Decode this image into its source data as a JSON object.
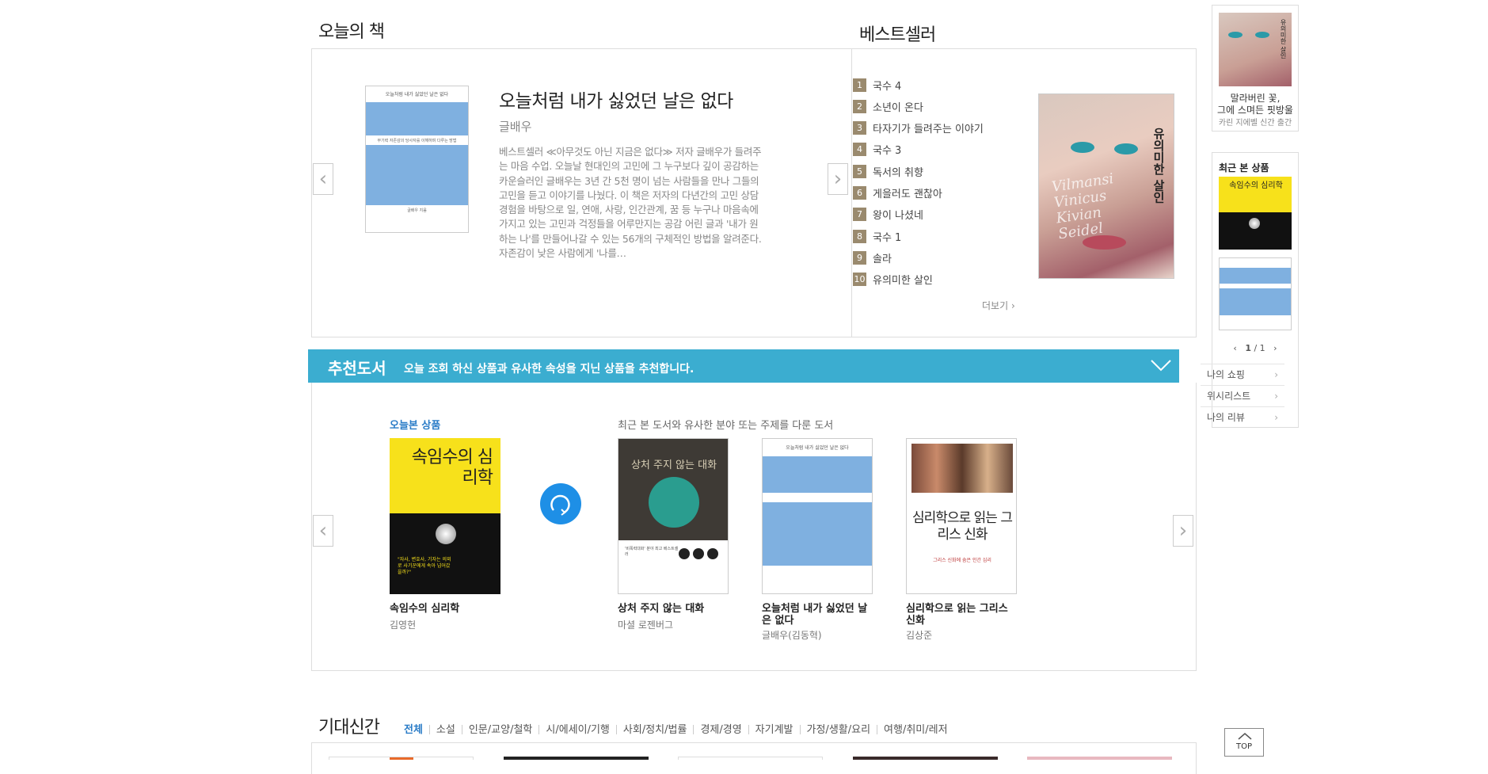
{
  "today_book": {
    "section_title": "오늘의 책",
    "book_title": "오늘처럼 내가 싫었던 날은 없다",
    "author": "글배우",
    "description": "베스트셀러 ≪아무것도 아닌 지금은 없다≫ 저자 글배우가 들려주는 마음 수업. 오늘날 현대인의 고민에 그 누구보다 깊이 공감하는 카운슬러인 글배우는 3년 간 5천 명이 넘는 사람들을 만나 그들의 고민을 듣고 이야기를 나눴다. 이 책은 저자의 다년간의 고민 상담 경험을 바탕으로 일, 연애, 사랑, 인간관계, 꿈 등 누구나 마음속에 가지고 있는 고민과 걱정들을 어루만지는 공감 어린 글과 '내가 원하는 나'를 만들어나갈 수 있는 56개의 구체적인 방법을 알려준다. 자존감이 낮은 사람에게 '나를…",
    "cover_top_text": "오늘처럼 내가 싫었던 날은 없다",
    "cover_mid_text": "무기력 자존감의 당사자를 이해하며 다루는 방법",
    "cover_author_text": "글배우 지음"
  },
  "bestseller": {
    "section_title": "베스트셀러",
    "items": [
      {
        "rank": "1",
        "title": "국수 4"
      },
      {
        "rank": "2",
        "title": "소년이 온다"
      },
      {
        "rank": "3",
        "title": "타자기가 들려주는 이야기"
      },
      {
        "rank": "4",
        "title": "국수 3"
      },
      {
        "rank": "5",
        "title": "독서의 취향"
      },
      {
        "rank": "6",
        "title": "게을러도 괜찮아"
      },
      {
        "rank": "7",
        "title": "왕이 나셨네"
      },
      {
        "rank": "8",
        "title": "국수 1"
      },
      {
        "rank": "9",
        "title": "솔라"
      },
      {
        "rank": "10",
        "title": "유의미한 살인"
      }
    ],
    "more_label": "더보기",
    "cover_title": "유의미한 살인",
    "cover_script": "Vilmansi Vinicus Kivian Seidel"
  },
  "recommend": {
    "title": "추천도서",
    "subtitle": "오늘 조회 하신 상품과 유사한 속성을 지닌 상품을 추천합니다.",
    "today_label": "오늘본 상품",
    "similar_label": "최근 본 도서와 유사한 분야 또는 주제를 다룬 도서",
    "books": [
      {
        "title": "속임수의 심리학",
        "author": "김영헌",
        "cover_text": "속임수의 심리학",
        "cover_note": "\"자사, 변호사, 기자는 의외로 사기꾼에게 속아 넘어갔을까?\""
      },
      {
        "title": "상처 주지 않는 대화",
        "author": "마셜 로젠버그",
        "cover_text": "상처 주지 않는 대화",
        "cover_note": "'비폭력대화' 분야 최고 베스트셀러"
      },
      {
        "title": "오늘처럼 내가 싫었던 날은 없다",
        "author": "글배우(김동혁)",
        "cover_text": "오늘처럼 내가 싫었던 날은 없다",
        "cover_note": ""
      },
      {
        "title": "심리학으로 읽는 그리스 신화",
        "author": "김상준",
        "cover_text": "심리학으로 읽는 그리스 신화",
        "cover_note": "그리스 신화에 숨은 인간 심리"
      }
    ]
  },
  "upcoming": {
    "title": "기대신간",
    "tabs": [
      "전체",
      "소설",
      "인문/교양/철학",
      "시/에세이/기행",
      "사회/정치/법률",
      "경제/경영",
      "자기계발",
      "가정/생활/요리",
      "여행/취미/레저"
    ]
  },
  "sidebar": {
    "ad_text_1": "말라버린 꽃,",
    "ad_text_2": "그에 스며든 핏방울",
    "ad_text_3": "카린 지에벨 신간 출간",
    "ad_cover_title": "유의미한 살인",
    "recent_title": "최근 본 상품",
    "recent_cover_1": "속임수의 심리학",
    "pager": "1",
    "pager_total": "/ 1",
    "links": [
      "나의 쇼핑",
      "위시리스트",
      "나의 리뷰"
    ],
    "top_label": "TOP"
  },
  "colors": {
    "accent": "#3badd0",
    "rank_badge": "#9a8a6e",
    "link_blue": "#2a7cc7"
  }
}
